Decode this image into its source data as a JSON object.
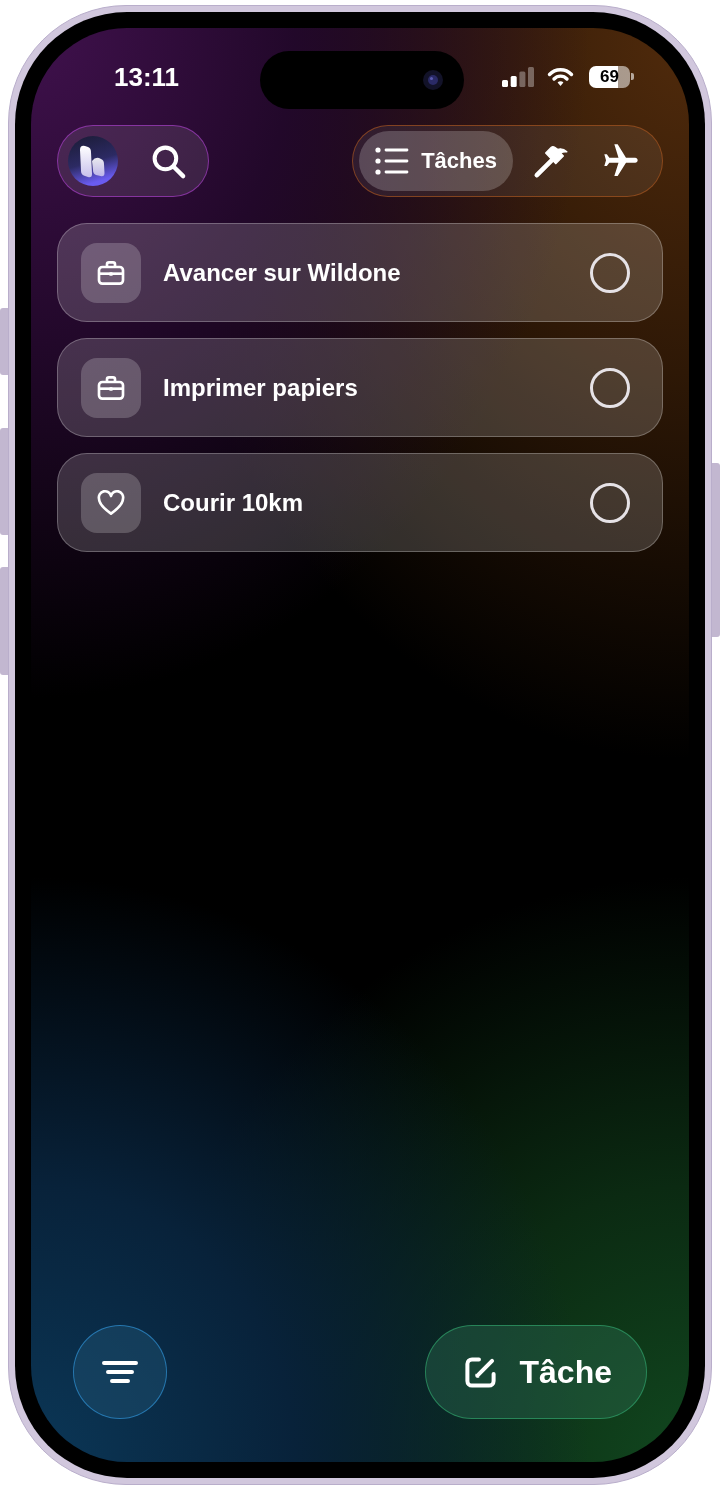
{
  "status_bar": {
    "time": "13:11",
    "battery": "69"
  },
  "header": {
    "tabs": [
      {
        "kind": "list",
        "label": "Tâches",
        "selected": true
      },
      {
        "kind": "hammer",
        "selected": false
      },
      {
        "kind": "airplane",
        "selected": false
      }
    ]
  },
  "tasks": [
    {
      "kind": "work",
      "title": "Avancer sur Wildone",
      "checked": false
    },
    {
      "kind": "work",
      "title": "Imprimer papiers",
      "checked": false
    },
    {
      "kind": "health",
      "title": "Courir 10km",
      "checked": false
    }
  ],
  "new_task_button": {
    "label": "Tâche"
  }
}
